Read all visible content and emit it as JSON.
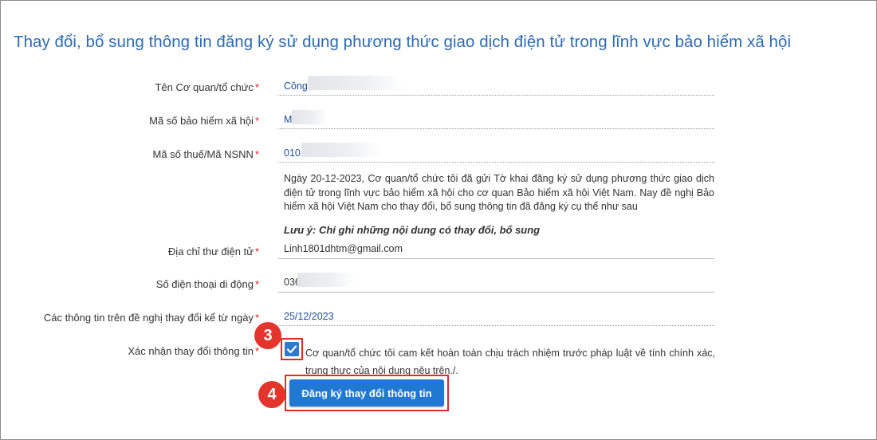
{
  "page": {
    "title": "Thay đổi, bổ sung thông tin đăng ký sử dụng phương thức giao dịch điện tử trong lĩnh vực bảo hiểm xã hội"
  },
  "form": {
    "required_mark": "*",
    "org_name": {
      "label": "Tên Cơ quan/tổ chức",
      "value": "Công"
    },
    "social_insurance_code": {
      "label": "Mã số bảo hiểm xã hội",
      "value": "M"
    },
    "tax_code": {
      "label": "Mã số thuế/Mã NSNN",
      "value": "010"
    },
    "note": "Ngày 20-12-2023, Cơ quan/tổ chức tôi đã gửi Tờ khai đăng ký sử dụng phương thức giao dịch điện tử trong lĩnh vực bảo hiểm xã hội cho cơ quan Bảo hiểm xã hội Việt Nam. Nay đề nghị Bảo hiểm xã hội Việt Nam cho thay đổi, bổ sung thông tin đã đăng ký cụ thể như sau",
    "note_emphasis": "Lưu ý: Chỉ ghi những nội dung có thay đổi, bổ sung",
    "email": {
      "label": "Địa chỉ thư điện tử",
      "value": "Linh1801dhtm@gmail.com"
    },
    "phone": {
      "label": "Số điện thoại di động",
      "value": "036"
    },
    "effective_date": {
      "label": "Các thông tin trên đề nghị thay đổi kể từ ngày",
      "value": "25/12/2023"
    },
    "confirm": {
      "label": "Xác nhận thay đổi thông tin",
      "checked": true,
      "text": "Cơ quan/tổ chức tôi cam kết hoàn toàn chịu trách nhiệm trước pháp luật về tính chính xác, trung thực của nội dung nêu trên./."
    },
    "submit_label": "Đăng ký thay đổi thông tin"
  },
  "annotations": {
    "step_checkbox": "3",
    "step_button": "4"
  },
  "colors": {
    "title": "#2d6bb3",
    "primary": "#1f78d1",
    "highlight": "#e02a2a",
    "required": "#e0201a"
  }
}
